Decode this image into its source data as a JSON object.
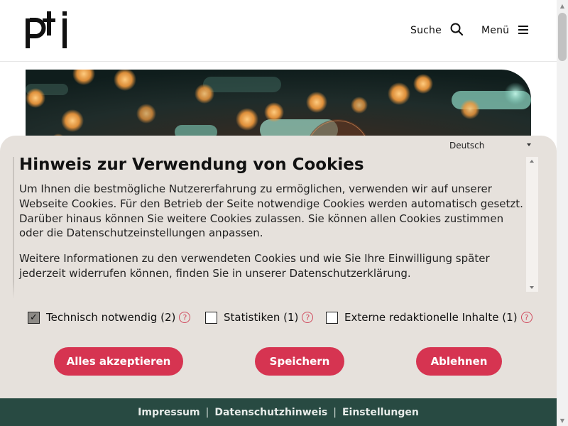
{
  "header": {
    "logo_text": "pti",
    "search_label": "Suche",
    "search_icon": "search-icon",
    "menu_label": "Menü",
    "menu_icon": "hamburger-icon"
  },
  "cookie": {
    "language": "Deutsch",
    "title": "Hinweis zur Verwendung von Cookies",
    "paragraph1": "Um Ihnen die bestmögliche Nutzererfahrung zu ermöglichen, verwenden wir auf unserer Webseite Cookies. Für den Betrieb der Seite notwendige Cookies werden automatisch gesetzt. Darüber hinaus können Sie weitere Cookies zulassen. Sie können allen Cookies zustimmen oder die Datenschutzeinstellungen anpassen.",
    "paragraph2": "Weitere Informationen zu den verwendeten Cookies und wie Sie Ihre Einwilligung später jederzeit widerrufen können, finden Sie in unserer Datenschutzerklärung.",
    "categories": [
      {
        "label": "Technisch notwendig (2)",
        "checked": true,
        "help": "?"
      },
      {
        "label": "Statistiken (1)",
        "checked": false,
        "help": "?"
      },
      {
        "label": "Externe redaktionelle Inhalte (1)",
        "checked": false,
        "help": "?"
      }
    ],
    "buttons": {
      "accept_all": "Alles akzeptieren",
      "save": "Speichern",
      "decline": "Ablehnen"
    }
  },
  "footer": {
    "links": [
      "Impressum",
      "Datenschutzhinweis",
      "Einstellungen"
    ],
    "separator": "|"
  },
  "colors": {
    "accent": "#d63451",
    "dialog_bg": "#e6e1dc",
    "footer_bg": "#284a42"
  }
}
